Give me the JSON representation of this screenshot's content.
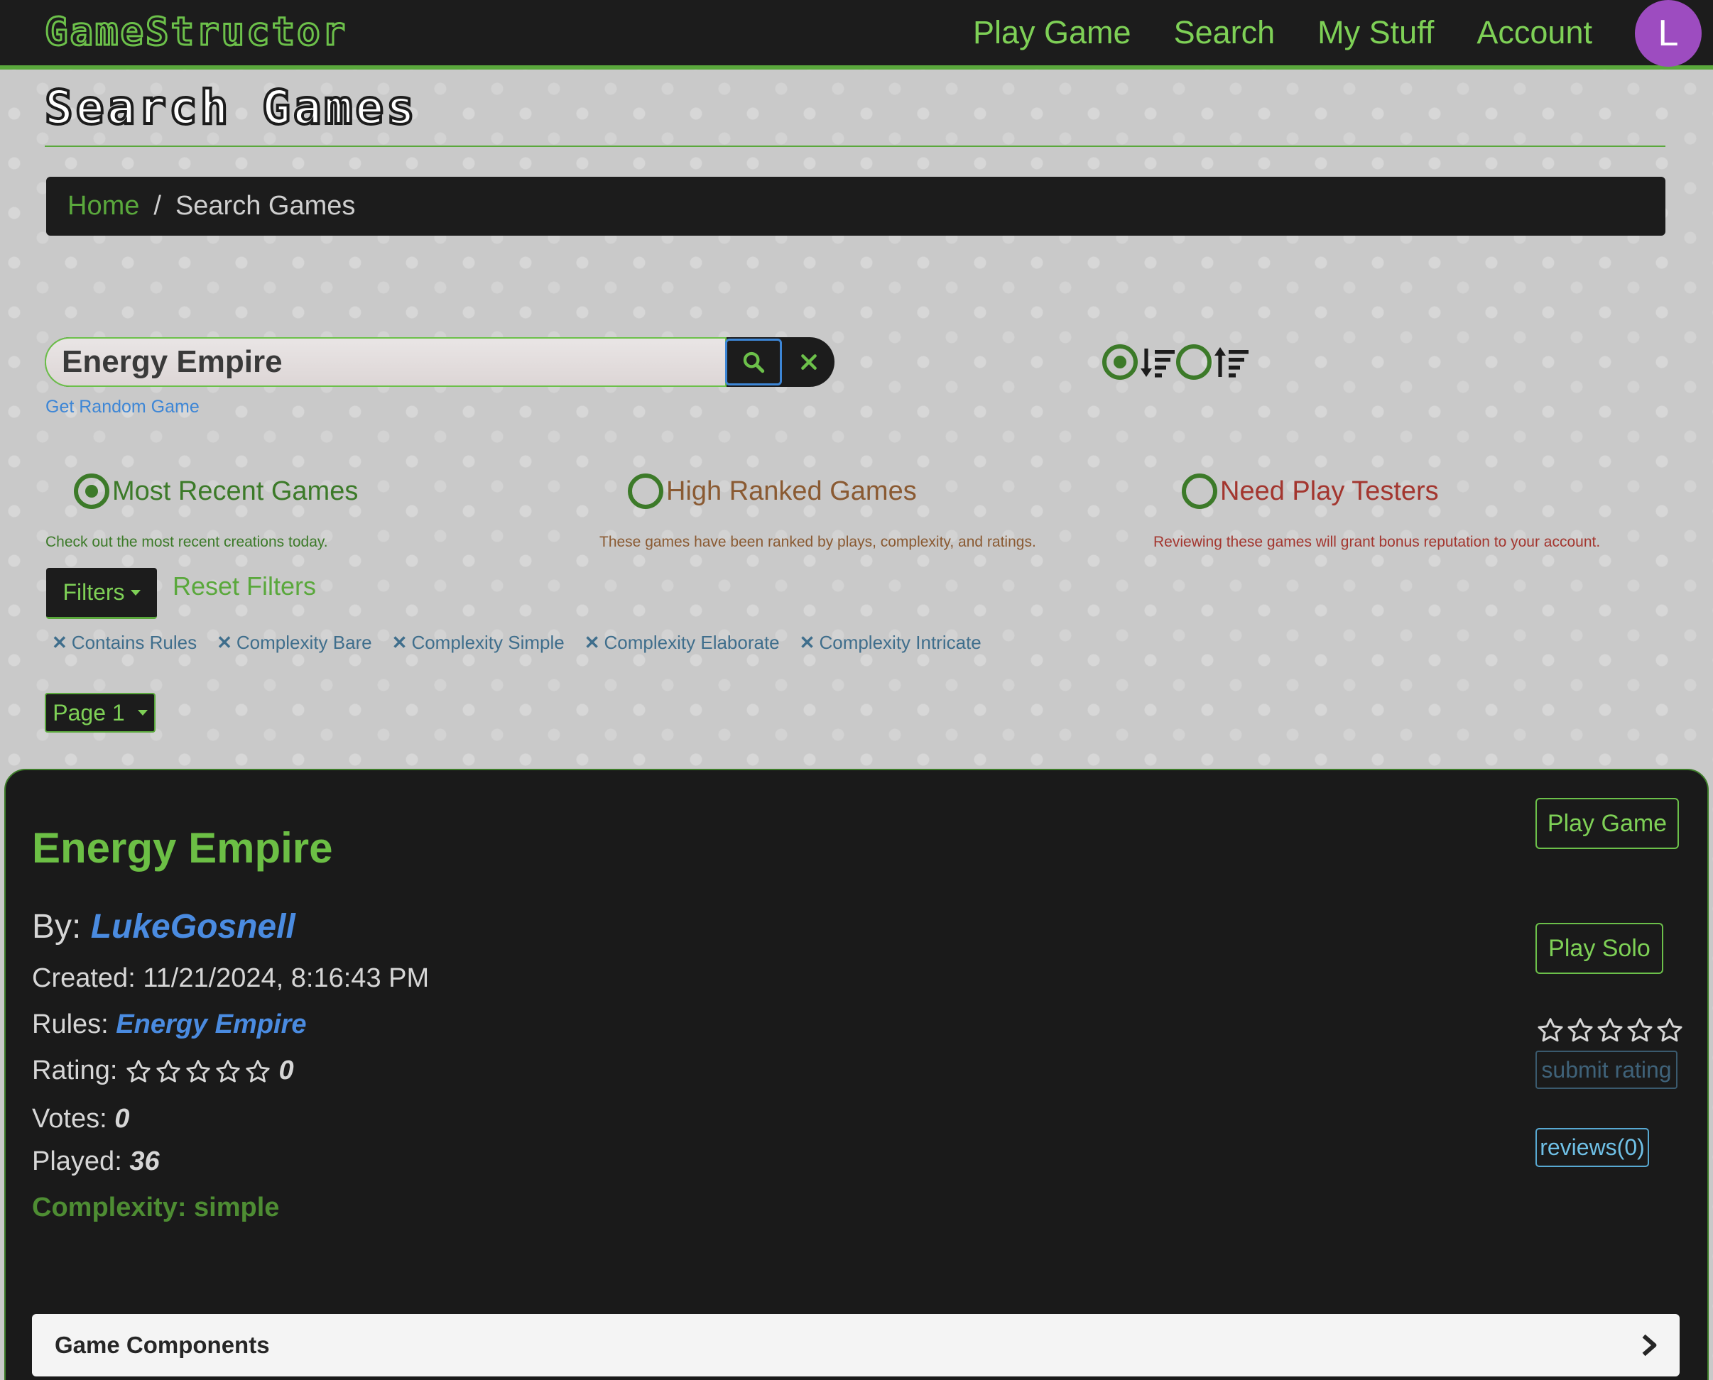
{
  "navbar": {
    "logo": "GameStructor",
    "links": [
      "Play Game",
      "Search",
      "My Stuff",
      "Account"
    ],
    "avatar_letter": "L",
    "avatar_color": "#9d4cc0",
    "accent_color": "#5aa83c"
  },
  "page": {
    "title": "Search Games",
    "breadcrumb": {
      "home": "Home",
      "separator": "/",
      "current": "Search Games"
    }
  },
  "search": {
    "value": "Energy Empire",
    "search_icon": "search-icon",
    "clear_icon": "close-icon",
    "random_link": "Get Random Game"
  },
  "sort": {
    "options": [
      {
        "icon": "sort-descending-icon",
        "checked": true
      },
      {
        "icon": "sort-ascending-icon",
        "checked": false
      }
    ]
  },
  "categories": [
    {
      "label": "Most Recent Games",
      "desc": "Check out the most recent creations today.",
      "checked": true,
      "color": "#3c7a29"
    },
    {
      "label": "High Ranked Games",
      "desc": "These games have been ranked by plays, complexity, and ratings.",
      "checked": false,
      "color": "#8a5a32"
    },
    {
      "label": "Need Play Testers",
      "desc": "Reviewing these games will grant bonus reputation to your account.",
      "checked": false,
      "color": "#a3362f"
    }
  ],
  "filters": {
    "button_label": "Filters",
    "reset_label": "Reset Filters",
    "active": [
      "Contains Rules",
      "Complexity Bare",
      "Complexity Simple",
      "Complexity Elaborate",
      "Complexity Intricate"
    ]
  },
  "pagination": {
    "label": "Page 1"
  },
  "game": {
    "title": "Energy Empire",
    "by_prefix": "By:",
    "author": "LukeGosnell",
    "created_label": "Created:",
    "created_value": "11/21/2024, 8:16:43 PM",
    "rules_label": "Rules:",
    "rules_value": "Energy Empire",
    "rating_label": "Rating:",
    "rating_value": "0",
    "rating_stars_filled": 0,
    "rating_stars_total": 5,
    "votes_label": "Votes:",
    "votes_value": "0",
    "played_label": "Played:",
    "played_value": "36",
    "complexity": "Complexity: simple",
    "play_game_label": "Play Game",
    "play_solo_label": "Play Solo",
    "submit_rating_label": "submit rating",
    "reviews_label": "reviews(0)",
    "components_label": "Game Components"
  }
}
